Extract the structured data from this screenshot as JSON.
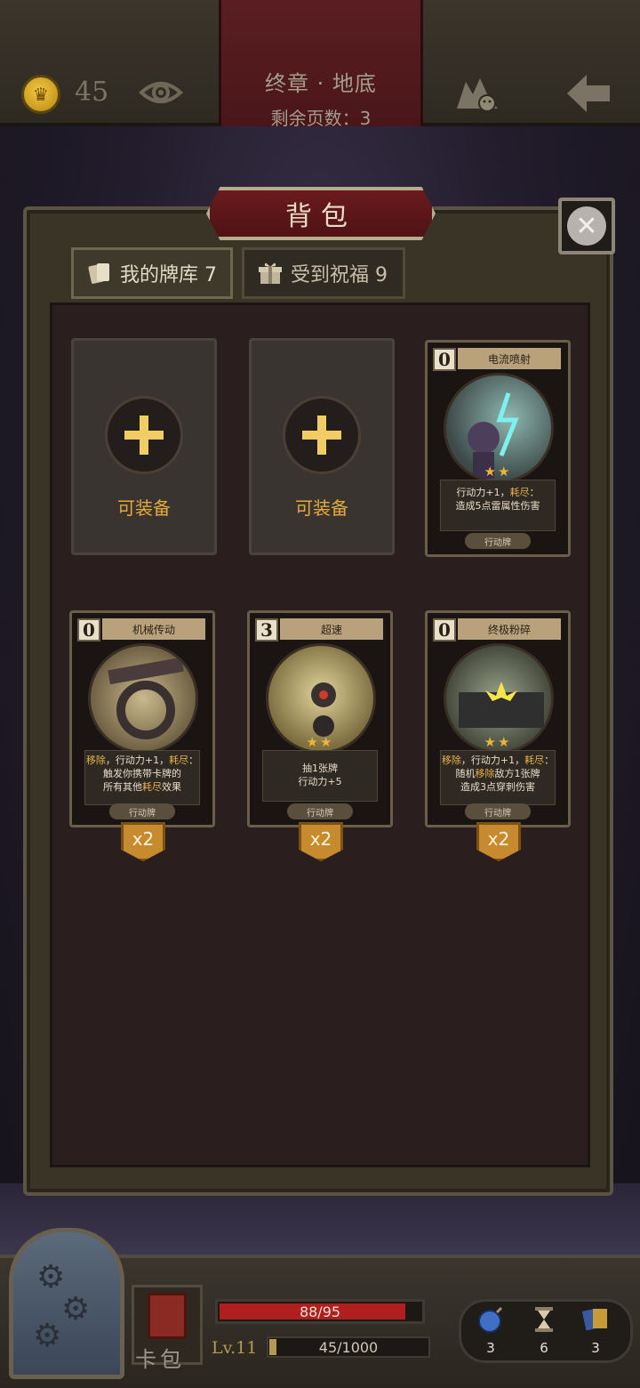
{
  "topbar": {
    "coins": "45",
    "chapter_title": "终章 · 地底",
    "pages_remaining": "剩余页数：3"
  },
  "panel": {
    "title": "背包",
    "tabs": [
      {
        "label": "我的牌库 7"
      },
      {
        "label": "受到祝福 9"
      }
    ],
    "slots": [
      {
        "label": "可装备"
      },
      {
        "label": "可装备"
      }
    ],
    "cards": [
      {
        "cost": "0",
        "name": "电流喷射",
        "stars": "★★",
        "desc_line1_plain": "行动力+1，",
        "desc_line1_hl": "耗尽",
        "desc_line1_end": "：",
        "desc_line2": "造成5点雷属性伤害",
        "type": "行动牌",
        "count": ""
      },
      {
        "cost": "0",
        "name": "机械传动",
        "stars": "",
        "desc_line1_hl": "移除",
        "desc_line1_plain": "，行动力+1，",
        "desc_line1_hl2": "耗尽",
        "desc_line1_end": "：",
        "desc_line2": "触发你携带卡牌的",
        "desc_line3_plain": "所有其他",
        "desc_line3_hl": "耗尽",
        "desc_line3_end": "效果",
        "type": "行动牌",
        "count": "x2"
      },
      {
        "cost": "3",
        "name": "超速",
        "stars": "★★",
        "desc_line1": "抽1张牌",
        "desc_line2": "行动力+5",
        "type": "行动牌",
        "count": "x2"
      },
      {
        "cost": "0",
        "name": "终极粉碎",
        "stars": "★★",
        "desc_line1_hl": "移除",
        "desc_line1_plain": "，行动力+1，",
        "desc_line1_hl2": "耗尽",
        "desc_line1_end": "：",
        "desc_line2_plain": "随机",
        "desc_line2_hl": "移除",
        "desc_line2_end": "敌方1张牌",
        "desc_line3": "造成3点穿刺伤害",
        "type": "行动牌",
        "count": "x2"
      }
    ]
  },
  "bottombar": {
    "deck_label": "卡包",
    "hp_text": "88/95",
    "hp_fraction": 0.926,
    "level": "Lv.11",
    "xp_text": "45/1000",
    "xp_fraction": 0.045,
    "resources": [
      {
        "icon": "bomb-icon",
        "value": "3"
      },
      {
        "icon": "hourglass-icon",
        "value": "6"
      },
      {
        "icon": "cards-icon",
        "value": "3"
      }
    ]
  },
  "colors": {
    "accent_gold": "#e3a93a",
    "header_red": "#6a1b1d",
    "hp_red": "#b01e1e"
  }
}
